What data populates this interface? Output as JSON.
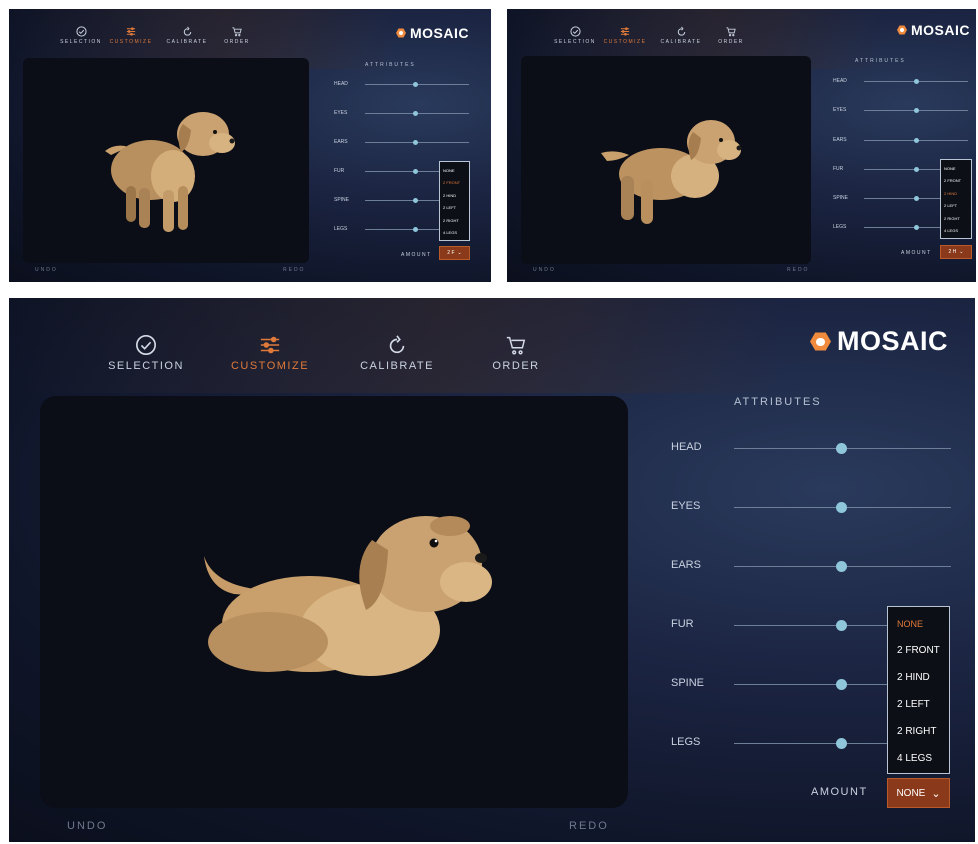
{
  "brand": {
    "name": "MOSAIC"
  },
  "nav": [
    {
      "label": "SELECTION",
      "icon": "check-circle-icon"
    },
    {
      "label": "CUSTOMIZE",
      "icon": "sliders-icon",
      "active": true
    },
    {
      "label": "CALIBRATE",
      "icon": "refresh-icon"
    },
    {
      "label": "ORDER",
      "icon": "cart-icon"
    }
  ],
  "attributes": {
    "title": "ATTRIBUTES",
    "rows": [
      "HEAD",
      "EYES",
      "EARS",
      "FUR",
      "SPINE",
      "LEGS"
    ]
  },
  "amount": {
    "label": "AMOUNT",
    "options": [
      "NONE",
      "2 FRONT",
      "2 HIND",
      "2 LEFT",
      "2 RIGHT",
      "4 LEGS"
    ]
  },
  "frames": [
    {
      "selected_option": "2 FRONT",
      "select_value": "2 F"
    },
    {
      "selected_option": "2 HIND",
      "select_value": "2 H"
    },
    {
      "selected_option": "NONE",
      "select_value": "NONE"
    }
  ],
  "footer": {
    "undo": "UNDO",
    "redo": "REDO"
  },
  "colors": {
    "accent": "#e07a3a",
    "knob": "#8fc6da",
    "logo_hex": "#f08a3c",
    "dog_fur": "#c9a06c"
  }
}
